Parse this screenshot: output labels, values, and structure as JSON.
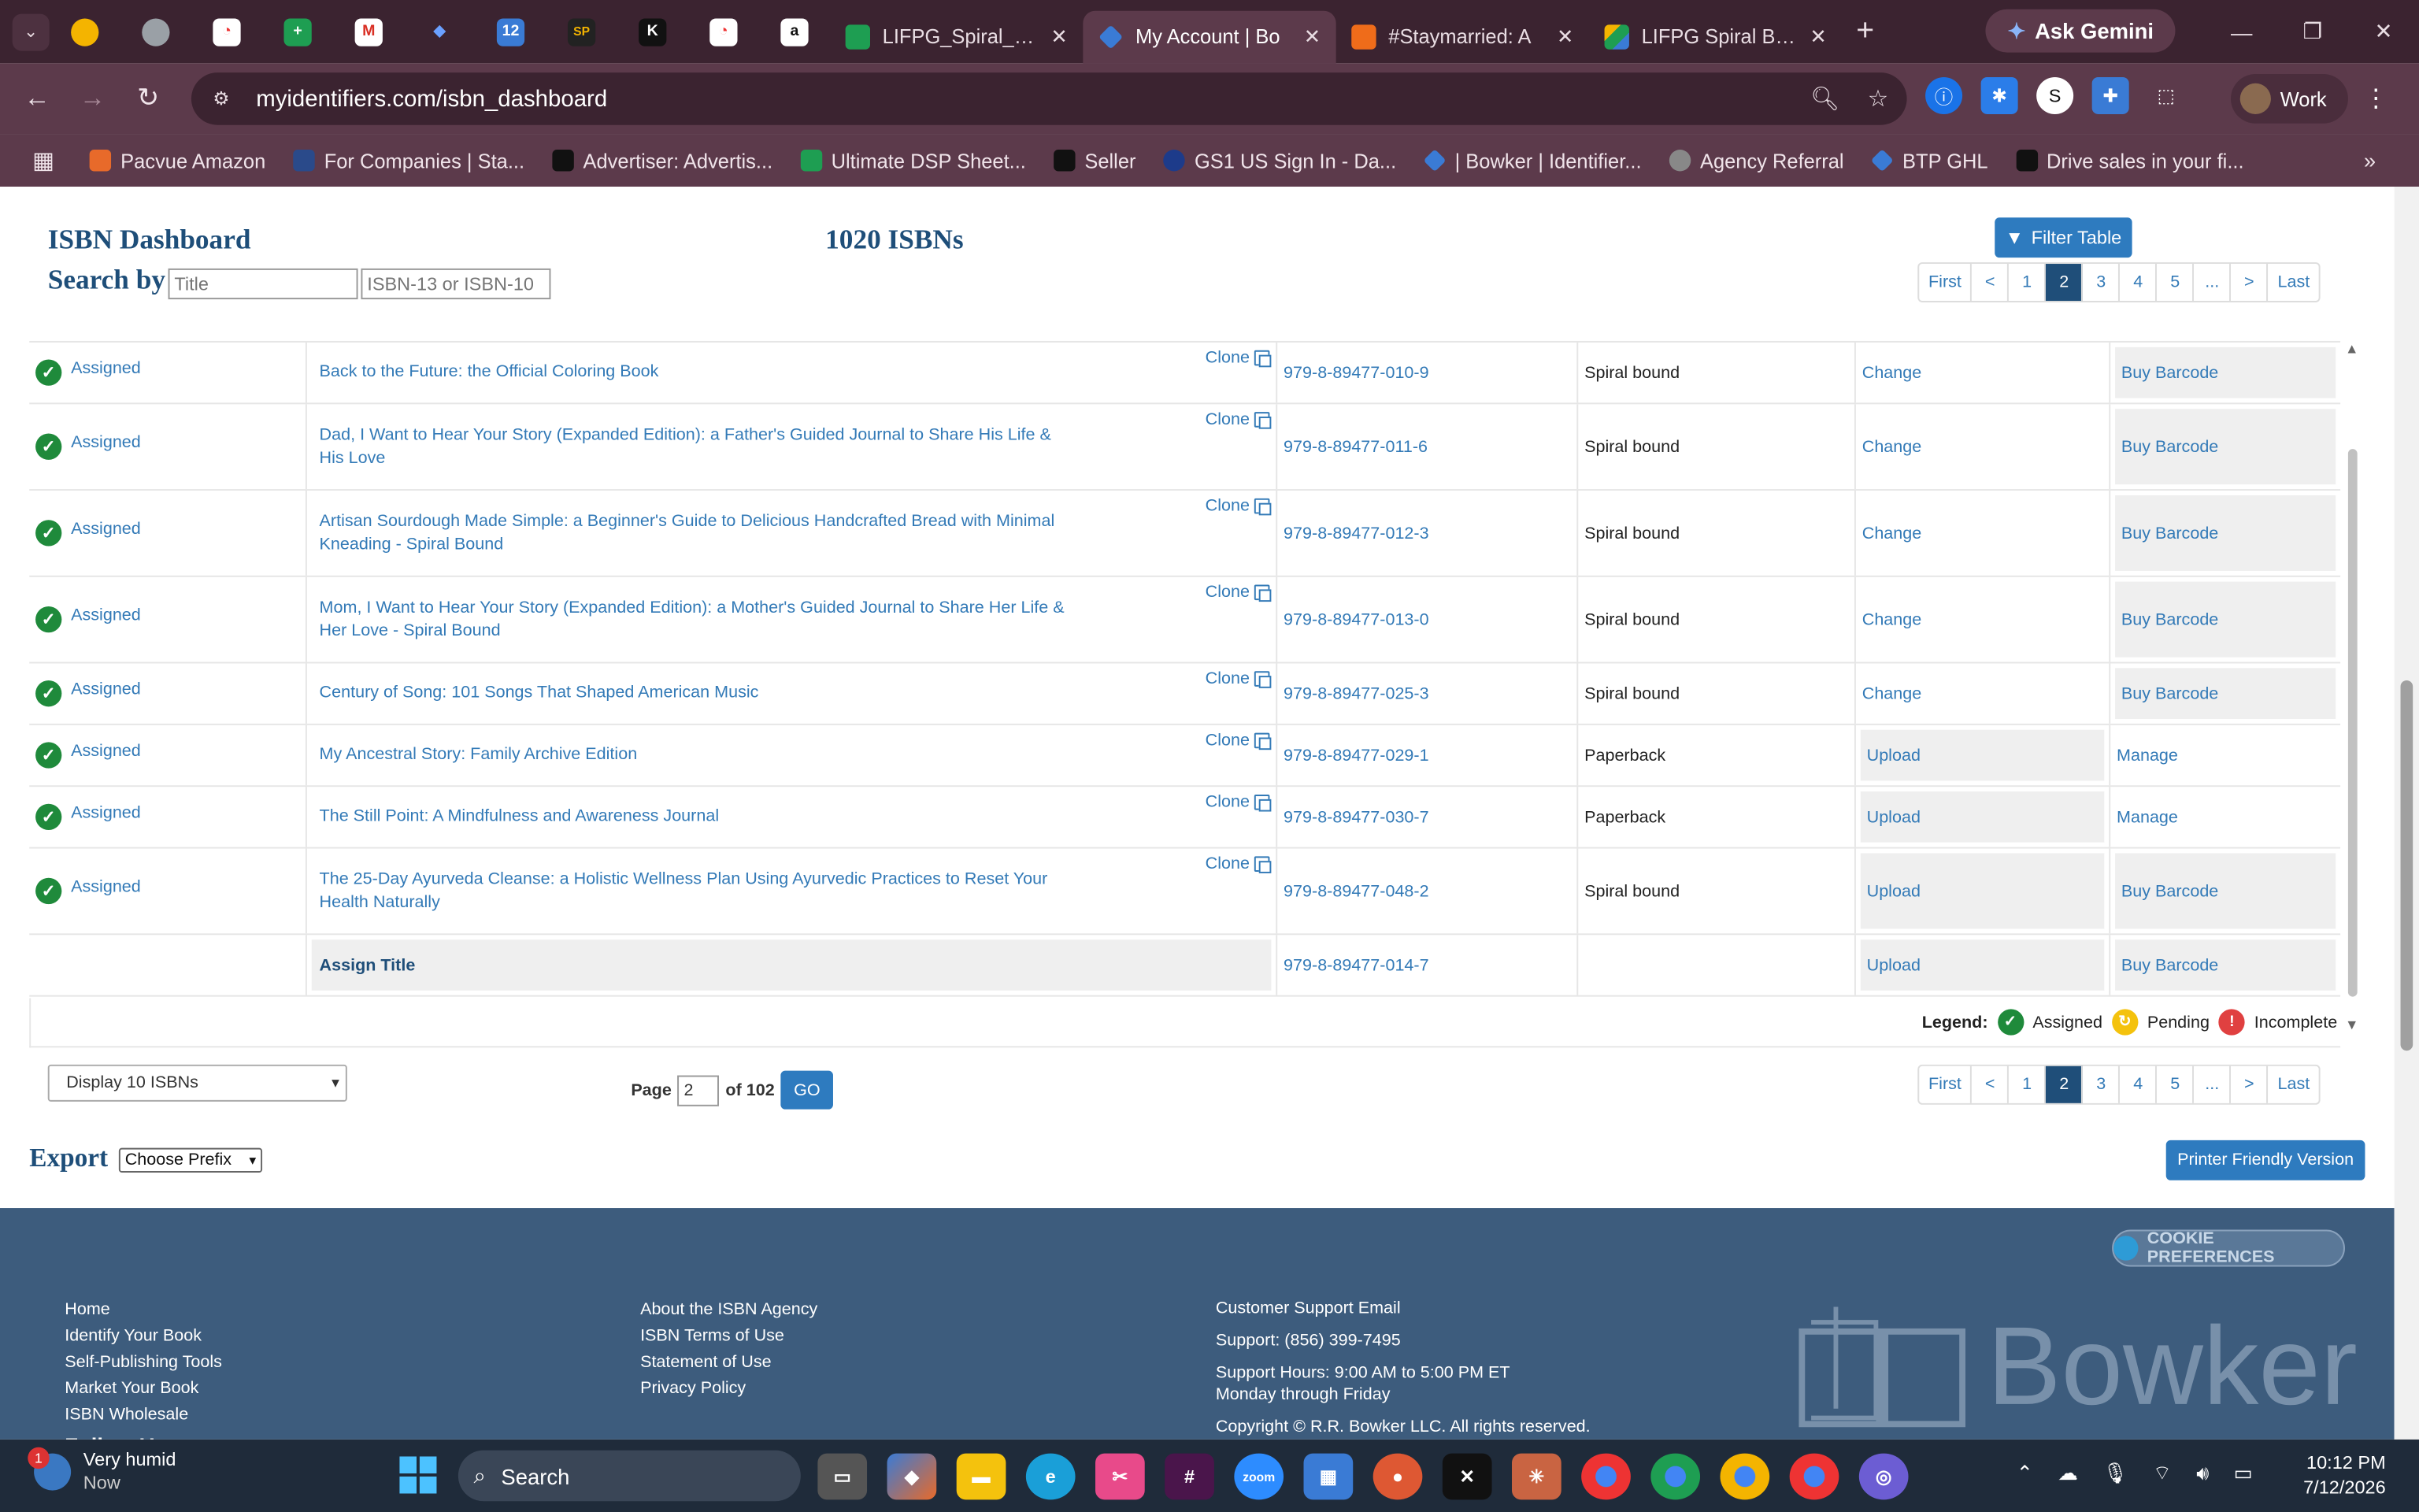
{
  "browser": {
    "tabs": [
      {
        "title": "LIFPG_Spiral_Pip",
        "color": "#1e9e52"
      },
      {
        "title": "My Account | Bo",
        "color": "#3a7bd5",
        "active": true
      },
      {
        "title": "#Staymarried: A",
        "color": "#ef6c1a"
      },
      {
        "title": "LIFPG Spiral Bou",
        "color": "#f4b400"
      }
    ],
    "gemini_label": "Ask Gemini",
    "url": "myidentifiers.com/isbn_dashboard",
    "profile_label": "Work",
    "bookmarks": [
      {
        "label": "Pacvue Amazon",
        "color": "#e86a2a"
      },
      {
        "label": "For Companies | Sta...",
        "color": "#2a4a8a"
      },
      {
        "label": "Advertiser: Advertis...",
        "color": "#222222"
      },
      {
        "label": "Ultimate DSP Sheet...",
        "color": "#1e9e52"
      },
      {
        "label": "Seller",
        "color": "#111111"
      },
      {
        "label": "GS1 US Sign In - Da...",
        "color": "#1d3b8a"
      },
      {
        "label": "| Bowker | Identifier...",
        "color": "#3a7bd5"
      },
      {
        "label": "Agency Referral",
        "color": "#888888"
      },
      {
        "label": "BTP GHL",
        "color": "#3a7bd5"
      },
      {
        "label": "Drive sales in your fi...",
        "color": "#111111"
      }
    ]
  },
  "dashboard": {
    "title": "ISBN Dashboard",
    "count": "1020 ISBNs",
    "search_label": "Search by",
    "title_placeholder": "Title",
    "isbn_placeholder": "ISBN-13 or ISBN-10",
    "filter_label": "Filter Table",
    "pager": [
      "First",
      "<",
      "1",
      "2",
      "3",
      "4",
      "5",
      "...",
      ">",
      "Last"
    ],
    "current_page": "2",
    "clone_label": "Clone",
    "rows": [
      {
        "status": "Assigned",
        "title": "Back to the Future: the Official Coloring Book",
        "isbn": "979-8-89477-010-9",
        "format": "Spiral bound",
        "action": "Change",
        "action_boxed": false,
        "buy": "Buy Barcode",
        "buy_boxed": true
      },
      {
        "status": "Assigned",
        "title": "Dad, I Want to Hear Your Story (Expanded Edition): a Father's Guided Journal to Share His Life & His Love",
        "isbn": "979-8-89477-011-6",
        "format": "Spiral bound",
        "action": "Change",
        "action_boxed": false,
        "buy": "Buy Barcode",
        "buy_boxed": true
      },
      {
        "status": "Assigned",
        "title": "Artisan Sourdough Made Simple: a Beginner's Guide to Delicious Handcrafted Bread with Minimal Kneading - Spiral Bound",
        "isbn": "979-8-89477-012-3",
        "format": "Spiral bound",
        "action": "Change",
        "action_boxed": false,
        "buy": "Buy Barcode",
        "buy_boxed": true
      },
      {
        "status": "Assigned",
        "title": "Mom, I Want to Hear Your Story (Expanded Edition): a Mother's Guided Journal to Share Her Life & Her Love - Spiral Bound",
        "isbn": "979-8-89477-013-0",
        "format": "Spiral bound",
        "action": "Change",
        "action_boxed": false,
        "buy": "Buy Barcode",
        "buy_boxed": true
      },
      {
        "status": "Assigned",
        "title": "Century of Song: 101 Songs That Shaped American Music",
        "isbn": "979-8-89477-025-3",
        "format": "Spiral bound",
        "action": "Change",
        "action_boxed": false,
        "buy": "Buy Barcode",
        "buy_boxed": true
      },
      {
        "status": "Assigned",
        "title": "My Ancestral Story: Family Archive Edition",
        "isbn": "979-8-89477-029-1",
        "format": "Paperback",
        "action": "Upload",
        "action_boxed": true,
        "buy": "Manage",
        "buy_boxed": false
      },
      {
        "status": "Assigned",
        "title": "The Still Point: A Mindfulness and Awareness Journal",
        "isbn": "979-8-89477-030-7",
        "format": "Paperback",
        "action": "Upload",
        "action_boxed": true,
        "buy": "Manage",
        "buy_boxed": false
      },
      {
        "status": "Assigned",
        "title": "The 25-Day Ayurveda Cleanse: a Holistic Wellness Plan Using Ayurvedic Practices to Reset Your Health Naturally",
        "isbn": "979-8-89477-048-2",
        "format": "Spiral bound",
        "action": "Upload",
        "action_boxed": true,
        "buy": "Buy Barcode",
        "buy_boxed": true
      }
    ],
    "assign_row": {
      "label": "Assign Title",
      "isbn": "979-8-89477-014-7",
      "action": "Upload",
      "buy": "Buy Barcode"
    },
    "legend": {
      "label": "Legend:",
      "assigned": "Assigned",
      "pending": "Pending",
      "incomplete": "Incomplete"
    },
    "display_select": "Display 10 ISBNs",
    "page_label": "Page",
    "page_value": "2",
    "of_label": "of 102",
    "go_label": "GO",
    "export_label": "Export",
    "prefix_select": "Choose Prefix",
    "print_label": "Printer Friendly Version"
  },
  "footer": {
    "cookie_label": "COOKIE PREFERENCES",
    "col1": [
      "Home",
      "Identify Your Book",
      "Self-Publishing Tools",
      "Market Your Book",
      "ISBN Wholesale",
      "Follow Us"
    ],
    "col2": [
      "About the ISBN Agency",
      "ISBN Terms of Use",
      "Statement of Use",
      "Privacy Policy"
    ],
    "col3": [
      "Customer Support Email",
      "Support: (856) 399-7495",
      "Support Hours: 9:00 AM to 5:00 PM ET",
      "Monday through Friday",
      "Copyright © R.R. Bowker LLC. All rights reserved."
    ],
    "brand": "Bowker"
  },
  "taskbar": {
    "weather_title": "Very humid",
    "weather_sub": "Now",
    "weather_badge": "1",
    "search_label": "Search",
    "time": "10:12 PM",
    "date": "7/12/2026"
  },
  "colors": {
    "accent": "#2e7bbf",
    "navy": "#1e4e79",
    "link": "#337ab7",
    "footer": "#3d5c7d",
    "success": "#1f8a3b"
  }
}
